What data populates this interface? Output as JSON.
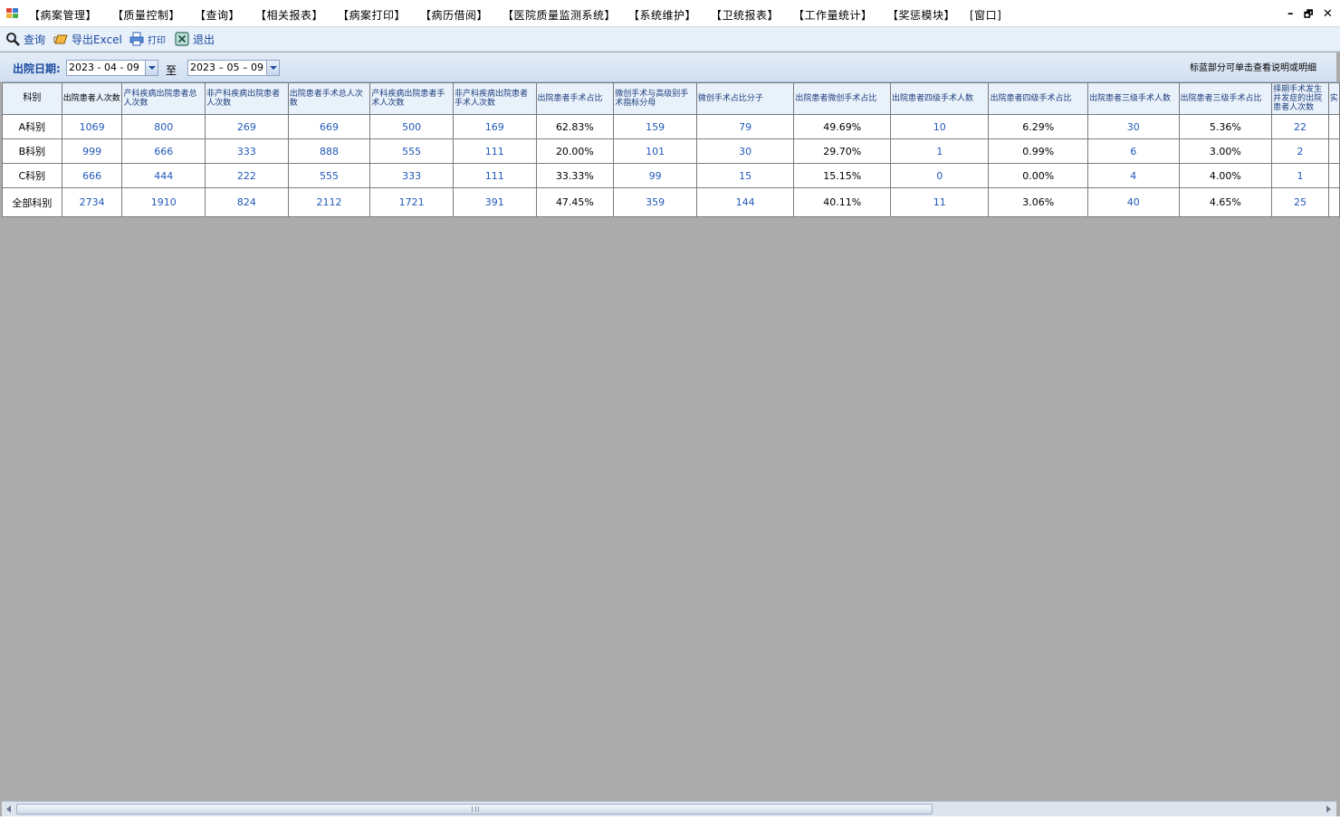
{
  "menubar": {
    "items": [
      "【病案管理】",
      "【质量控制】",
      "【查询】",
      "【相关报表】",
      "【病案打印】",
      "【病历借阅】",
      "【医院质量监测系统】",
      "【系统维护】",
      "【卫统报表】",
      "【工作量统计】",
      "【奖惩模块】",
      "[窗口]"
    ],
    "window_controls": {
      "minimize": "–",
      "restore": "🗗",
      "close": "✕"
    }
  },
  "toolbar": {
    "query": {
      "label": "查询",
      "icon": "magnifier-icon"
    },
    "export": {
      "label": "导出Excel",
      "icon": "export-excel-icon"
    },
    "print": {
      "label": "打印",
      "icon": "printer-icon"
    },
    "exit": {
      "label": "退出",
      "icon": "exit-icon"
    }
  },
  "filter": {
    "label": "出院日期:",
    "start_date": "2023 - 04 - 09",
    "to_label": "至",
    "end_date": "2023 – 05 – 09",
    "hint": "标蓝部分可单击查看说明或明细"
  },
  "grid": {
    "headers": [
      "科别",
      "出院患者人次数",
      "产科疾病出院患者总人次数",
      "非产科疾病出院患者人次数",
      "出院患者手术总人次数",
      "产科疾病出院患者手术人次数",
      "非产科疾病出院患者手术人次数",
      "出院患者手术占比",
      "微创手术与高级别手术指标分母",
      "微创手术占比分子",
      "出院患者微创手术占比",
      "出院患者四级手术人数",
      "出院患者四级手术占比",
      "出院患者三级手术人数",
      "出院患者三级手术占比",
      "择期手术发生并发症的出院患者人次数",
      "实"
    ],
    "rows": [
      [
        "A科别",
        "1069",
        "800",
        "269",
        "669",
        "500",
        "169",
        "62.83%",
        "159",
        "79",
        "49.69%",
        "10",
        "6.29%",
        "30",
        "5.36%",
        "22",
        ""
      ],
      [
        "B科别",
        "999",
        "666",
        "333",
        "888",
        "555",
        "111",
        "20.00%",
        "101",
        "30",
        "29.70%",
        "1",
        "0.99%",
        "6",
        "3.00%",
        "2",
        ""
      ],
      [
        "C科别",
        "666",
        "444",
        "222",
        "555",
        "333",
        "111",
        "33.33%",
        "99",
        "15",
        "15.15%",
        "0",
        "0.00%",
        "4",
        "4.00%",
        "1",
        ""
      ],
      [
        "全部科别",
        "2734",
        "1910",
        "824",
        "2112",
        "1721",
        "391",
        "47.45%",
        "359",
        "144",
        "40.11%",
        "11",
        "3.06%",
        "40",
        "4.65%",
        "25",
        ""
      ]
    ],
    "link_color": "#2159b8",
    "header_color": "#1d3d7a"
  },
  "colors": {
    "workspace_bg": "#ababab",
    "toolbar_bg": "#e8f0fa",
    "filterbar_bg": "#d2e0f2",
    "accent": "#1a4aa0"
  }
}
